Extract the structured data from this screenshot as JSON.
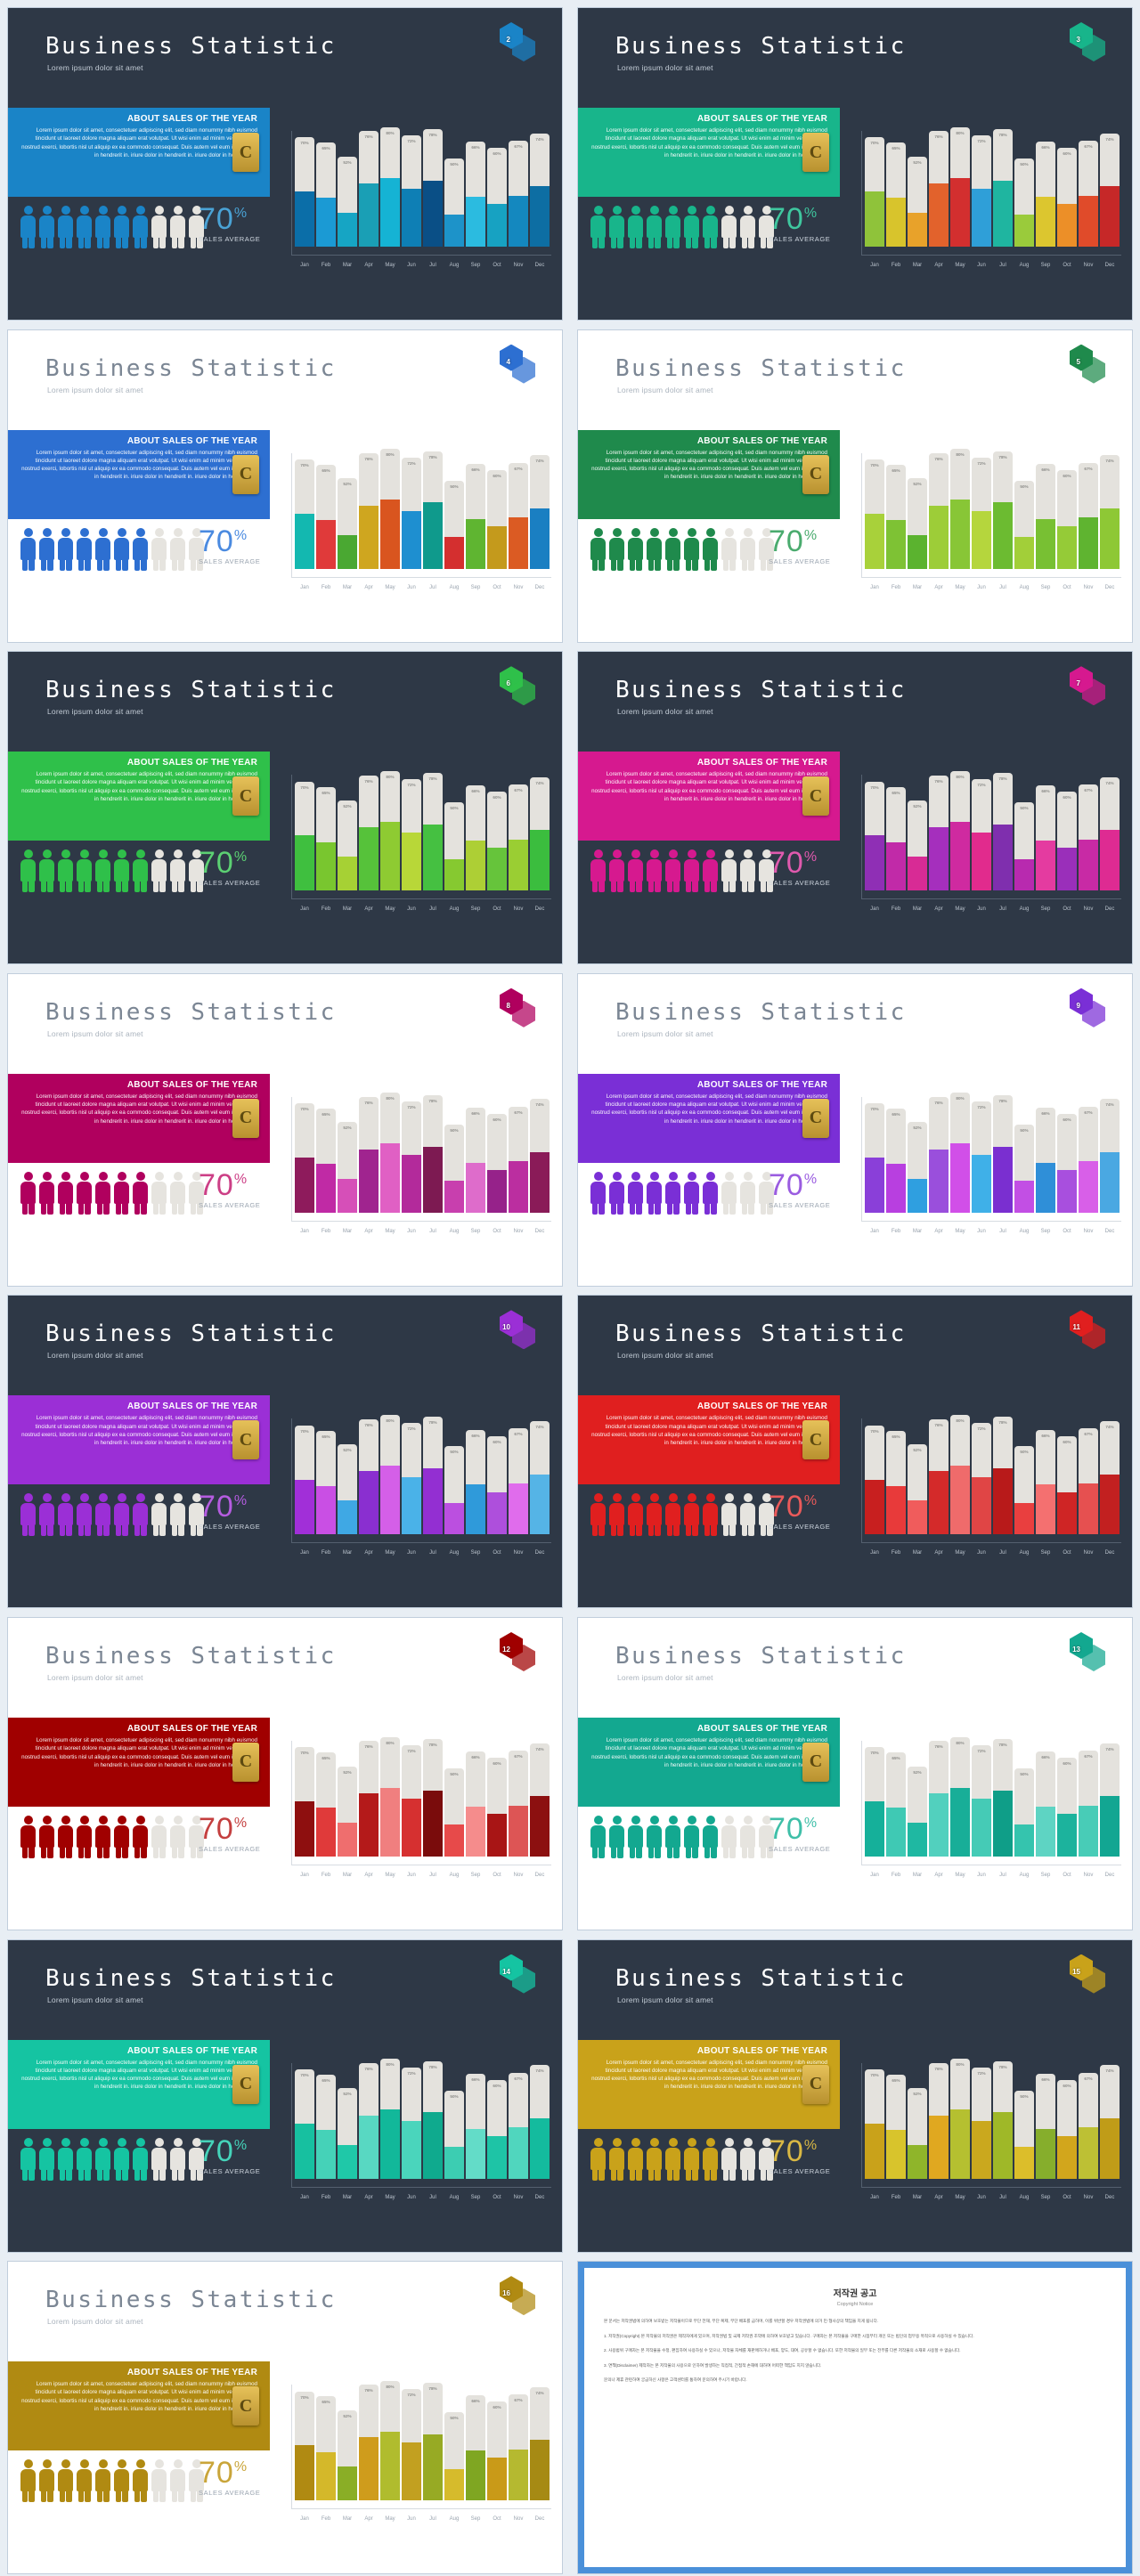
{
  "slide_common": {
    "title": "Business Statistic",
    "subtitle": "Lorem ipsum dolor sit amet",
    "panel_heading": "ABOUT SALES OF THE YEAR",
    "panel_body": "Lorem ipsum dolor sit amet, consectetuer adipiscing elit, sed diam nonummy nibh euismod tincidunt ut laoreet dolore magna aliquam erat volutpat. Ut wisi enim ad minim veniam, quis nostrud exerci, lobortis nisl ut aliquip ex ea commodo consequat. Duis autem vel eum iriure dolor in hendrerit in. iriure dolor in hendrerit in. iriure dolor in hendrerit in.",
    "percent_value": "70",
    "percent_symbol": "%",
    "percent_caption": "SALES AVERAGE",
    "people_filled": 7,
    "people_empty": 3,
    "coin_glyph": "C"
  },
  "chart_data": {
    "type": "bar",
    "title": "About Sales of the Year",
    "xlabel": "",
    "ylabel": "",
    "ylim": [
      0,
      100
    ],
    "grid": false,
    "legend": "none",
    "categories": [
      "Jan",
      "Feb",
      "Mar",
      "Apr",
      "May",
      "Jun",
      "Jul",
      "Aug",
      "Sep",
      "Oct",
      "Nov",
      "Dec"
    ],
    "values": [
      70,
      65,
      52,
      76,
      80,
      72,
      78,
      50,
      66,
      60,
      67,
      74
    ],
    "value_labels": [
      "70%",
      "65%",
      "52%",
      "76%",
      "80%",
      "72%",
      "78%",
      "50%",
      "66%",
      "60%",
      "67%",
      "74%"
    ]
  },
  "slides": [
    {
      "number": "2",
      "theme": "dark",
      "accent": "#1a84c7",
      "panel": "#1a84c7",
      "pct_color": "#4aa3d6",
      "bar_colors": [
        "#0b6ea8",
        "#1b9ad4",
        "#16a5c4",
        "#1a9fb5",
        "#15b3d4",
        "#0e7fb5",
        "#0a4f86",
        "#1d93c9",
        "#2bbbe0",
        "#17a2c2",
        "#1488bf",
        "#0d6ea3"
      ]
    },
    {
      "number": "3",
      "theme": "dark",
      "accent": "#18b58b",
      "panel": "#18b58b",
      "pct_color": "#3fc79f",
      "bar_colors": [
        "#8fc33a",
        "#d8c42c",
        "#e8a22a",
        "#e2622c",
        "#d32f2f",
        "#2f9fd8",
        "#1fb5a0",
        "#9acb3b",
        "#dcc62f",
        "#ec8f28",
        "#e04b2a",
        "#c62828"
      ]
    },
    {
      "number": "4",
      "theme": "light",
      "accent": "#2d6fd1",
      "panel": "#2d6fd1",
      "pct_color": "#4a8ae0",
      "bar_colors": [
        "#13b8b0",
        "#e03a3a",
        "#4aa832",
        "#cfa61f",
        "#d9551f",
        "#1e8fd0",
        "#0f9a8c",
        "#d42f2f",
        "#5fb531",
        "#c49a1c",
        "#db5b23",
        "#1a7fc2"
      ]
    },
    {
      "number": "5",
      "theme": "light",
      "accent": "#1f8a4c",
      "panel": "#1f8a4c",
      "pct_color": "#4aab6e",
      "bar_colors": [
        "#a8d13a",
        "#7ec234",
        "#5bb32f",
        "#9dcd38",
        "#88c636",
        "#b5d63d",
        "#6cbb31",
        "#a2cf39",
        "#78c033",
        "#95cb37",
        "#5fb430",
        "#8ec835"
      ]
    },
    {
      "number": "6",
      "theme": "dark",
      "accent": "#2fc04a",
      "panel": "#2fc04a",
      "pct_color": "#5cd173",
      "bar_colors": [
        "#3fbf3f",
        "#79c62f",
        "#a6d134",
        "#56c23a",
        "#8ecb32",
        "#b8d738",
        "#45c041",
        "#86c930",
        "#adcf35",
        "#66c43b",
        "#9ace33",
        "#3bbd3e"
      ]
    },
    {
      "number": "7",
      "theme": "dark",
      "accent": "#d6198f",
      "panel": "#d6198f",
      "pct_color": "#e05aae",
      "bar_colors": [
        "#8f2fb5",
        "#c12aa8",
        "#d82b95",
        "#a52fbd",
        "#cf2aa0",
        "#e12b8d",
        "#7f2fae",
        "#b82aaf",
        "#e43ba0",
        "#9a2fba",
        "#c82aa5",
        "#de2b92"
      ]
    },
    {
      "number": "8",
      "theme": "light",
      "accent": "#b0005e",
      "panel": "#b0005e",
      "pct_color": "#cc3f86",
      "bar_colors": [
        "#8e1b5c",
        "#c02aa5",
        "#d64fb8",
        "#a0248f",
        "#e060c4",
        "#b32a9b",
        "#7d1a52",
        "#c83fae",
        "#de6ccb",
        "#96228a",
        "#bb2ea0",
        "#8a1b58"
      ]
    },
    {
      "number": "9",
      "theme": "light",
      "accent": "#7a2fd6",
      "panel": "#7a2fd6",
      "pct_color": "#9a5ce0",
      "bar_colors": [
        "#8a3fd9",
        "#b83fe0",
        "#2f9fe0",
        "#9a4fdc",
        "#d14fe8",
        "#3fb0e8",
        "#7a2fd0",
        "#c24fe4",
        "#2f8fd8",
        "#a84fde",
        "#d85fe8",
        "#4aa8e2"
      ]
    },
    {
      "number": "10",
      "theme": "dark",
      "accent": "#9b2fd6",
      "panel": "#9b2fd6",
      "pct_color": "#b55ce0",
      "bar_colors": [
        "#a12fd8",
        "#c94fe4",
        "#3fa8e4",
        "#8a2fd0",
        "#d45fe8",
        "#4ab2e8",
        "#932fd2",
        "#bb4fe0",
        "#2f9ada",
        "#ae4fdc",
        "#e06cec",
        "#55b4e6"
      ]
    },
    {
      "number": "11",
      "theme": "dark",
      "accent": "#e01f1f",
      "panel": "#e01f1f",
      "pct_color": "#ea5a5a",
      "bar_colors": [
        "#c81f1f",
        "#e83a3a",
        "#f05c5c",
        "#d42a2a",
        "#ef6b6b",
        "#e04545",
        "#b81a1a",
        "#e93f3f",
        "#f47070",
        "#cf2525",
        "#e65050",
        "#c22020"
      ]
    },
    {
      "number": "12",
      "theme": "light",
      "accent": "#a00000",
      "panel": "#a00000",
      "pct_color": "#c43f3f",
      "bar_colors": [
        "#8e0f0f",
        "#e03a3a",
        "#ef6e6e",
        "#b41a1a",
        "#f07f7f",
        "#d63030",
        "#7a0c0c",
        "#e74a4a",
        "#f58c8c",
        "#a81515",
        "#dd5555",
        "#8c1010"
      ]
    },
    {
      "number": "13",
      "theme": "light",
      "accent": "#13a890",
      "panel": "#13a890",
      "pct_color": "#3fbfa8",
      "bar_colors": [
        "#15b09a",
        "#3fc9b4",
        "#1fb8a2",
        "#52d0be",
        "#18ae98",
        "#45cbb6",
        "#0f9e88",
        "#35c4ae",
        "#5ed4c3",
        "#1cb39d",
        "#48ccb7",
        "#12a692"
      ]
    },
    {
      "number": "14",
      "theme": "dark",
      "accent": "#15c4a2",
      "panel": "#15c4a2",
      "pct_color": "#45d4ba",
      "bar_colors": [
        "#17c0a0",
        "#45d2b8",
        "#1fc8a8",
        "#58d8c2",
        "#12b89a",
        "#4ad5bc",
        "#0faa8e",
        "#3ccdb2",
        "#63dcc8",
        "#1ec4a6",
        "#50d6be",
        "#14bb9e"
      ]
    },
    {
      "number": "15",
      "theme": "dark",
      "accent": "#c9a21a",
      "panel": "#c9a21a",
      "pct_color": "#d9b844",
      "bar_colors": [
        "#c9a21a",
        "#d8c42c",
        "#8fb52a",
        "#e0a820",
        "#b5c030",
        "#caa81e",
        "#9fb828",
        "#dcbe2a",
        "#86ae2c",
        "#d2a61c",
        "#bdc034",
        "#c09c18"
      ]
    },
    {
      "number": "16",
      "theme": "light",
      "accent": "#b08a12",
      "panel": "#b08a12",
      "pct_color": "#c9a53a",
      "bar_colors": [
        "#b08a12",
        "#d4b82a",
        "#8aae26",
        "#cf9c1c",
        "#b0bc2e",
        "#c2a020",
        "#97aa24",
        "#d6bb2c",
        "#7fa622",
        "#c99a18",
        "#b5b930",
        "#a68a14"
      ]
    }
  ],
  "copyright_slide": {
    "title": "저작권 공고",
    "subtitle": "Copyright Notice",
    "paragraphs": [
      "본 문서는 저작권법에 의하여 보호받는 저작물이므로 무단 전재, 무단 복제, 무단 배포를 금하며, 이를 위반할 경우 저작권법에 의거 민·형사상의 책임을 지게 됩니다.",
      "1. 저작권(Copyright) 본 저작물의 저작권은 제작자에게 있으며, 저작권법 및 국제 저작권 조약에 의하여 보호받고 있습니다. 구매자는 본 저작물을 구매한 시점부터 개인 또는 법인의 업무용 목적으로 사용하실 수 있습니다.",
      "2. 사용범위 구매자는 본 저작물을 수정, 편집하여 사용하실 수 있으나, 저작물 자체를 재판매하거나 배포, 양도, 대여, 공유할 수 없습니다. 또한 저작물의 일부 또는 전부를 다른 저작물의 소재로 사용할 수 없습니다.",
      "3. 면책(Disclaimer) 제작자는 본 저작물의 사용으로 인하여 발생하는 직접적, 간접적 손해에 대하여 어떠한 책임도 지지 않습니다.",
      "문의나 제휴 관련하여 궁금하신 사항은 고객센터를 통하여 문의하여 주시기 바랍니다."
    ]
  }
}
